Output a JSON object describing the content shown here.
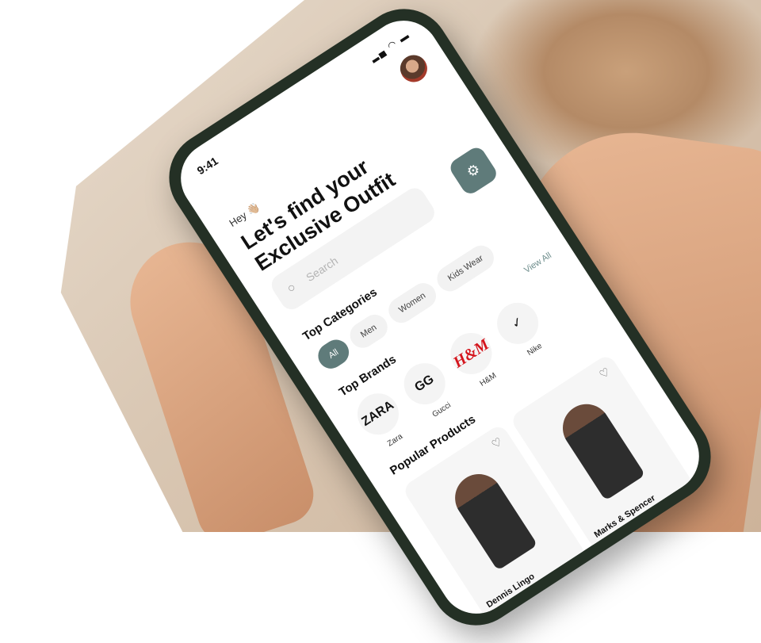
{
  "status": {
    "time": "9:41",
    "icons": "▂▄ ◠ ▬"
  },
  "greeting": "Hey 👋🏼",
  "headline": "Let's find your Exclusive Outfit",
  "search": {
    "placeholder": "Search"
  },
  "filter_icon": "sliders-icon",
  "sections": {
    "categories": "Top Categories",
    "brands": "Top Brands",
    "products": "Popular Products",
    "view_all": "View All"
  },
  "categories": [
    {
      "label": "All",
      "active": true
    },
    {
      "label": "Men"
    },
    {
      "label": "Women"
    },
    {
      "label": "Kids Wear"
    }
  ],
  "brands": [
    {
      "logo": "ZARA",
      "name": "Zara"
    },
    {
      "logo": "GG",
      "name": "Gucci"
    },
    {
      "logo": "H&M",
      "name": "H&M"
    },
    {
      "logo": "✓",
      "name": "Nike"
    }
  ],
  "products": [
    {
      "name": "Dennis Lingo"
    },
    {
      "name": "Marks & Spencer"
    }
  ],
  "colors": {
    "accent": "#5f7b7a",
    "hm_red": "#d4141c"
  }
}
